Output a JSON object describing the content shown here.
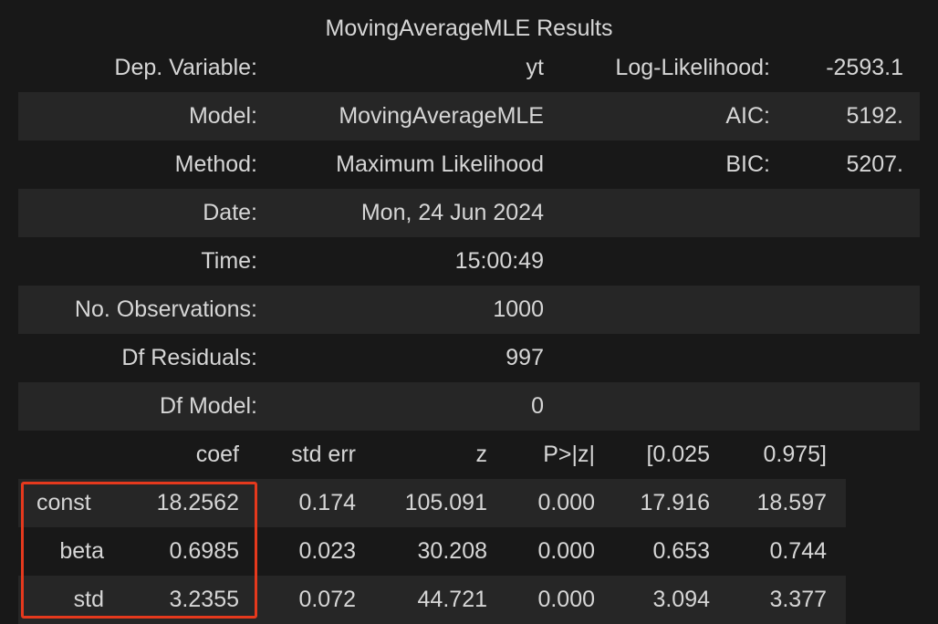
{
  "title": "MovingAverageMLE Results",
  "header": {
    "rows": [
      {
        "label": "Dep. Variable:",
        "value": "yt",
        "stat": "Log-Likelihood:",
        "num": "-2593.1"
      },
      {
        "label": "Model:",
        "value": "MovingAverageMLE",
        "stat": "AIC:",
        "num": "5192."
      },
      {
        "label": "Method:",
        "value": "Maximum Likelihood",
        "stat": "BIC:",
        "num": "5207."
      },
      {
        "label": "Date:",
        "value": "Mon, 24 Jun 2024",
        "stat": "",
        "num": ""
      },
      {
        "label": "Time:",
        "value": "15:00:49",
        "stat": "",
        "num": ""
      },
      {
        "label": "No. Observations:",
        "value": "1000",
        "stat": "",
        "num": ""
      },
      {
        "label": "Df Residuals:",
        "value": "997",
        "stat": "",
        "num": ""
      },
      {
        "label": "Df Model:",
        "value": "0",
        "stat": "",
        "num": ""
      }
    ]
  },
  "coef_table": {
    "columns": [
      "",
      "coef",
      "std err",
      "z",
      "P>|z|",
      "[0.025",
      "0.975]"
    ],
    "rows": [
      {
        "name": "const",
        "coef": "18.2562",
        "se": "0.174",
        "z": "105.091",
        "p": "0.000",
        "lo": "17.916",
        "hi": "18.597"
      },
      {
        "name": "beta",
        "coef": "0.6985",
        "se": "0.023",
        "z": "30.208",
        "p": "0.000",
        "lo": "0.653",
        "hi": "0.744"
      },
      {
        "name": "std",
        "coef": "3.2355",
        "se": "0.072",
        "z": "44.721",
        "p": "0.000",
        "lo": "3.094",
        "hi": "3.377"
      }
    ]
  },
  "colors": {
    "background": "#181818",
    "stripe": "#262626",
    "text": "#d6d6d6",
    "highlight": "#e5391d"
  }
}
